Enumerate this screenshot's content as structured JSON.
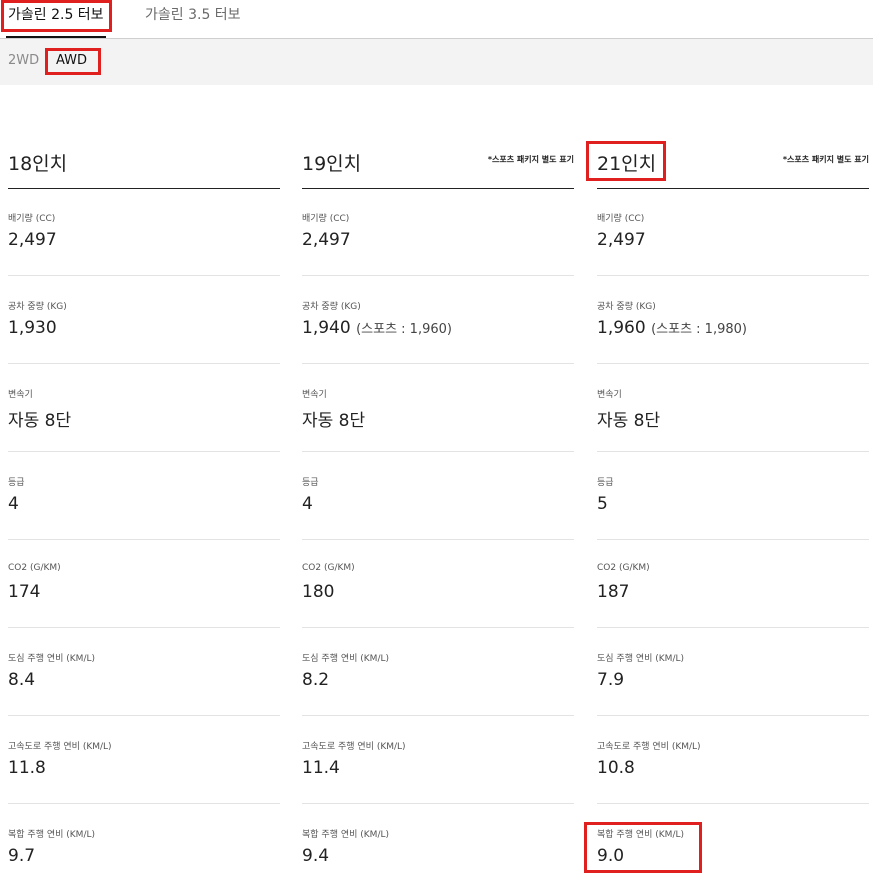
{
  "tabs": [
    {
      "label": "가솔린 2.5 터보",
      "active": true
    },
    {
      "label": "가솔린 3.5 터보",
      "active": false
    }
  ],
  "drive_tabs": [
    {
      "label": "2WD",
      "active": false
    },
    {
      "label": "AWD",
      "active": true
    }
  ],
  "columns": [
    {
      "title": "18인치",
      "note": "",
      "specs": [
        {
          "label": "배기량 (CC)",
          "value": "2,497",
          "extra": ""
        },
        {
          "label": "공차 중량 (KG)",
          "value": "1,930",
          "extra": ""
        },
        {
          "label": "변속기",
          "value": "자동 8단",
          "extra": ""
        },
        {
          "label": "등급",
          "value": "4",
          "extra": ""
        },
        {
          "label": "CO2 (G/KM)",
          "value": "174",
          "extra": ""
        },
        {
          "label": "도심 주행 연비 (KM/L)",
          "value": "8.4",
          "extra": ""
        },
        {
          "label": "고속도로 주행 연비 (KM/L)",
          "value": "11.8",
          "extra": ""
        },
        {
          "label": "복합 주행 연비 (KM/L)",
          "value": "9.7",
          "extra": ""
        }
      ]
    },
    {
      "title": "19인치",
      "note": "*스포츠 패키지 별도 표기",
      "specs": [
        {
          "label": "배기량 (CC)",
          "value": "2,497",
          "extra": ""
        },
        {
          "label": "공차 중량 (KG)",
          "value": "1,940",
          "extra": "(스포츠 : 1,960)"
        },
        {
          "label": "변속기",
          "value": "자동 8단",
          "extra": ""
        },
        {
          "label": "등급",
          "value": "4",
          "extra": ""
        },
        {
          "label": "CO2 (G/KM)",
          "value": "180",
          "extra": ""
        },
        {
          "label": "도심 주행 연비 (KM/L)",
          "value": "8.2",
          "extra": ""
        },
        {
          "label": "고속도로 주행 연비 (KM/L)",
          "value": "11.4",
          "extra": ""
        },
        {
          "label": "복합 주행 연비 (KM/L)",
          "value": "9.4",
          "extra": ""
        }
      ]
    },
    {
      "title": "21인치",
      "note": "*스포츠 패키지 별도 표기",
      "specs": [
        {
          "label": "배기량 (CC)",
          "value": "2,497",
          "extra": ""
        },
        {
          "label": "공차 중량 (KG)",
          "value": "1,960",
          "extra": "(스포츠 : 1,980)"
        },
        {
          "label": "변속기",
          "value": "자동 8단",
          "extra": ""
        },
        {
          "label": "등급",
          "value": "5",
          "extra": ""
        },
        {
          "label": "CO2 (G/KM)",
          "value": "187",
          "extra": ""
        },
        {
          "label": "도심 주행 연비 (KM/L)",
          "value": "7.9",
          "extra": ""
        },
        {
          "label": "고속도로 주행 연비 (KM/L)",
          "value": "10.8",
          "extra": ""
        },
        {
          "label": "복합 주행 연비 (KM/L)",
          "value": "9.0",
          "extra": ""
        }
      ]
    }
  ],
  "colors": {
    "highlight": "#e0201f",
    "subbar_bg": "#f3f3f3",
    "text": "#222222"
  }
}
